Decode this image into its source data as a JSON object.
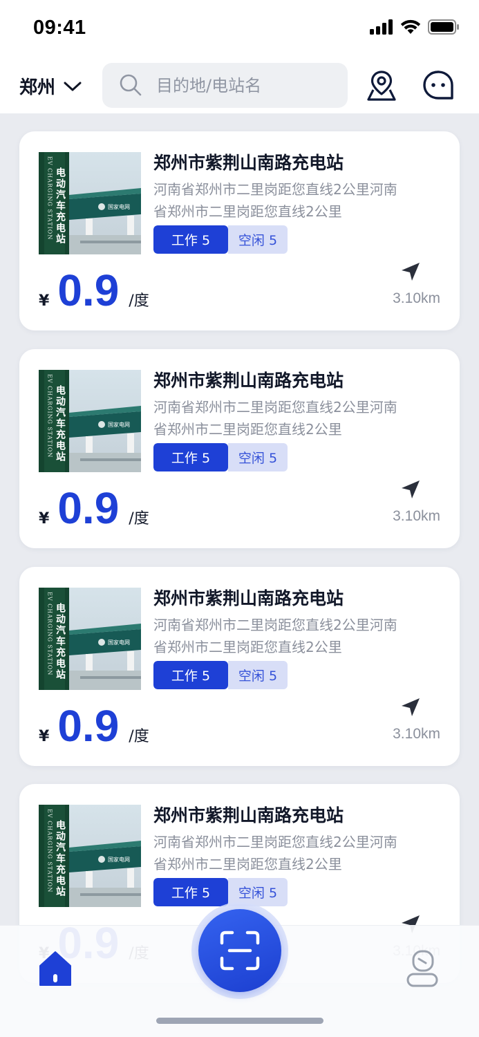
{
  "status_bar": {
    "time": "09:41"
  },
  "header": {
    "city": "郑州",
    "search_placeholder": "目的地/电站名"
  },
  "stations": [
    {
      "name": "郑州市紫荆山南路充电站",
      "address": "河南省郑州市二里岗距您直线2公里河南省郑州市二里岗距您直线2公里",
      "work_tag": "工作 5",
      "idle_tag": "空闲 5",
      "currency": "¥",
      "price": "0.9",
      "unit": "/度",
      "distance": "3.10km"
    },
    {
      "name": "郑州市紫荆山南路充电站",
      "address": "河南省郑州市二里岗距您直线2公里河南省郑州市二里岗距您直线2公里",
      "work_tag": "工作 5",
      "idle_tag": "空闲 5",
      "currency": "¥",
      "price": "0.9",
      "unit": "/度",
      "distance": "3.10km"
    },
    {
      "name": "郑州市紫荆山南路充电站",
      "address": "河南省郑州市二里岗距您直线2公里河南省郑州市二里岗距您直线2公里",
      "work_tag": "工作 5",
      "idle_tag": "空闲 5",
      "currency": "¥",
      "price": "0.9",
      "unit": "/度",
      "distance": "3.10km"
    },
    {
      "name": "郑州市紫荆山南路充电站",
      "address": "河南省郑州市二里岗距您直线2公里河南省郑州市二里岗距您直线2公里",
      "work_tag": "工作 5",
      "idle_tag": "空闲 5",
      "currency": "¥",
      "price": "0.9",
      "unit": "/度",
      "distance": "3.10km"
    }
  ],
  "thumbnail": {
    "sign_text": "电动汽车充电站",
    "sign_text_en": "EV CHARGING STATION",
    "canopy_text": "国家电网"
  },
  "bottom_nav": {
    "home_icon": "home-icon",
    "scan_icon": "scan-icon",
    "profile_icon": "profile-icon"
  },
  "colors": {
    "accent": "#1e40d6",
    "idle_bg": "#d8def7",
    "text_muted": "#8b909c"
  }
}
